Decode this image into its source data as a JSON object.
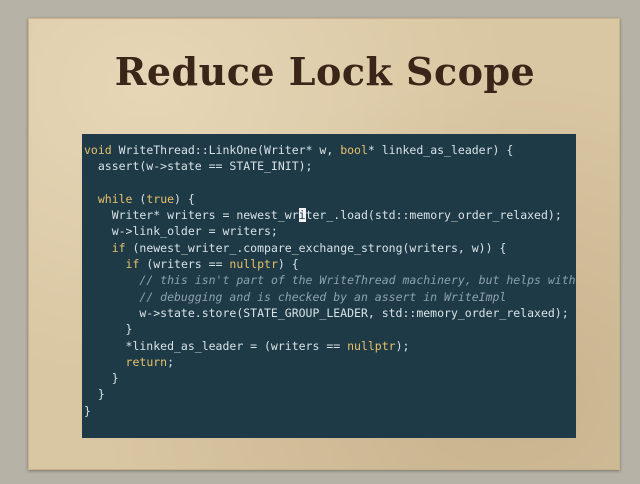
{
  "slide": {
    "title": "Reduce Lock Scope"
  },
  "code": {
    "lines": [
      [
        {
          "t": "void",
          "c": "kw"
        },
        {
          "t": " WriteThread::LinkOne(Writer* w, "
        },
        {
          "t": "bool",
          "c": "kw"
        },
        {
          "t": "* linked_as_leader) {"
        }
      ],
      [
        {
          "t": "  assert(w->state == STATE_INIT);"
        }
      ],
      [
        {
          "t": ""
        }
      ],
      [
        {
          "t": "  "
        },
        {
          "t": "while",
          "c": "kw"
        },
        {
          "t": " ("
        },
        {
          "t": "true",
          "c": "kw"
        },
        {
          "t": ") {"
        }
      ],
      [
        {
          "t": "    Writer* writers = newest_wr"
        },
        {
          "t": "i",
          "c": "cursor"
        },
        {
          "t": "ter_.load(std::memory_order_relaxed);"
        }
      ],
      [
        {
          "t": "    w->link_older = writers;"
        }
      ],
      [
        {
          "t": "    "
        },
        {
          "t": "if",
          "c": "kw"
        },
        {
          "t": " (newest_writer_.compare_exchange_strong(writers, w)) {"
        }
      ],
      [
        {
          "t": "      "
        },
        {
          "t": "if",
          "c": "kw"
        },
        {
          "t": " (writers == "
        },
        {
          "t": "nullptr",
          "c": "kw"
        },
        {
          "t": ") {"
        }
      ],
      [
        {
          "t": "        "
        },
        {
          "t": "// this isn't part of the WriteThread machinery, but helps with",
          "c": "cm"
        }
      ],
      [
        {
          "t": "        "
        },
        {
          "t": "// debugging and is checked by an assert in WriteImpl",
          "c": "cm"
        }
      ],
      [
        {
          "t": "        w->state.store(STATE_GROUP_LEADER, std::memory_order_relaxed);"
        }
      ],
      [
        {
          "t": "      }"
        }
      ],
      [
        {
          "t": "      *linked_as_leader = (writers == "
        },
        {
          "t": "nullptr",
          "c": "kw"
        },
        {
          "t": ");"
        }
      ],
      [
        {
          "t": "      "
        },
        {
          "t": "return",
          "c": "kw"
        },
        {
          "t": ";"
        }
      ],
      [
        {
          "t": "    }"
        }
      ],
      [
        {
          "t": "  }"
        }
      ],
      [
        {
          "t": "}"
        }
      ]
    ]
  },
  "colors": {
    "slide_background": "#d9c6a2",
    "code_background": "#1e3a47",
    "keyword": "#e6c06a",
    "comment": "#8ca3ad",
    "code_text": "#d8e2e6",
    "title_text": "#3b2418"
  }
}
